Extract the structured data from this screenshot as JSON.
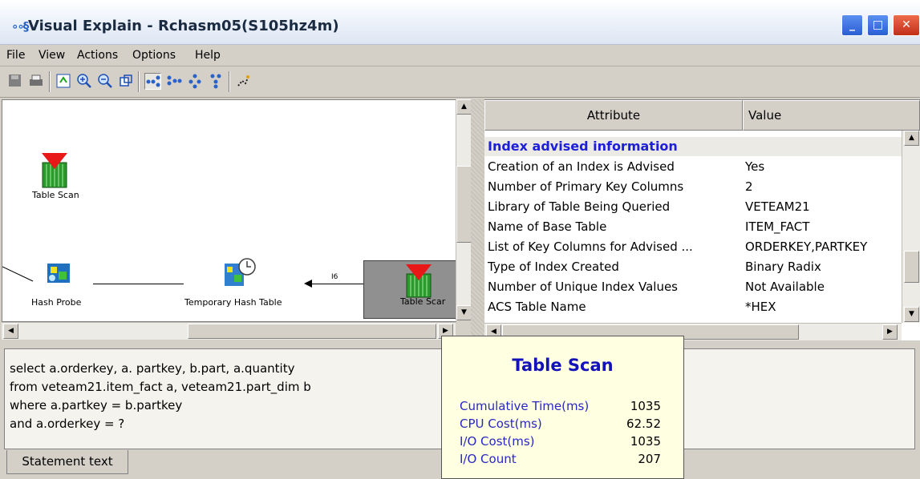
{
  "window": {
    "title": "Visual Explain - Rchasm05(S105hz4m)",
    "icon_glyph": "∘∘§",
    "min_glyph": "_",
    "max_glyph": "□",
    "close_glyph": "✕"
  },
  "menu": [
    "File",
    "View",
    "Actions",
    "Options",
    "Help"
  ],
  "toolbar": {
    "icons": [
      "save-icon",
      "print-icon",
      "refresh-icon",
      "zoom-in-icon",
      "zoom-out-icon",
      "overview-icon",
      "graph-view-icon",
      "horizontal-view-icon",
      "tree-view-icon",
      "vertical-view-icon",
      "highlight-icon"
    ]
  },
  "graph": {
    "nodes": [
      {
        "label": "Table Scan"
      },
      {
        "label": "Hash Probe"
      },
      {
        "label": "Temporary Hash Table"
      },
      {
        "label": "Table Scar"
      }
    ],
    "edge_label": "I6"
  },
  "attributes": {
    "headers": [
      "Attribute",
      "Value"
    ],
    "section": "Index advised information",
    "rows": [
      {
        "attr": "Creation of an Index is Advised",
        "value": "Yes"
      },
      {
        "attr": "Number of Primary Key Columns",
        "value": "2"
      },
      {
        "attr": "Library of Table Being Queried",
        "value": "VETEAM21"
      },
      {
        "attr": "Name of Base Table",
        "value": "ITEM_FACT"
      },
      {
        "attr": "List of Key Columns for Advised ...",
        "value": "ORDERKEY,PARTKEY"
      },
      {
        "attr": "Type of Index Created",
        "value": "Binary Radix"
      },
      {
        "attr": "Number of Unique Index Values",
        "value": "Not Available"
      },
      {
        "attr": "ACS Table Name",
        "value": "*HEX"
      }
    ]
  },
  "statement": {
    "lines": [
      "select a.orderkey, a. partkey, b.part, a.quantity",
      "from veteam21.item_fact a, veteam21.part_dim b",
      "where a.partkey = b.partkey",
      "and a.orderkey = ?"
    ],
    "tab_label": "Statement text"
  },
  "tooltip": {
    "title": "Table Scan",
    "metrics": [
      {
        "label": "Cumulative Time(ms)",
        "value": "1035"
      },
      {
        "label": "CPU Cost(ms)",
        "value": "62.52"
      },
      {
        "label": "I/O Cost(ms)",
        "value": "1035"
      },
      {
        "label": "I/O Count",
        "value": "207"
      }
    ]
  },
  "colors": {
    "section_text": "#1d20d8",
    "tooltip_bg": "#ffffe1",
    "tooltip_title": "#1212b8",
    "table_scan_red": "#e81818",
    "table_scan_green": "#2a9a2a"
  }
}
